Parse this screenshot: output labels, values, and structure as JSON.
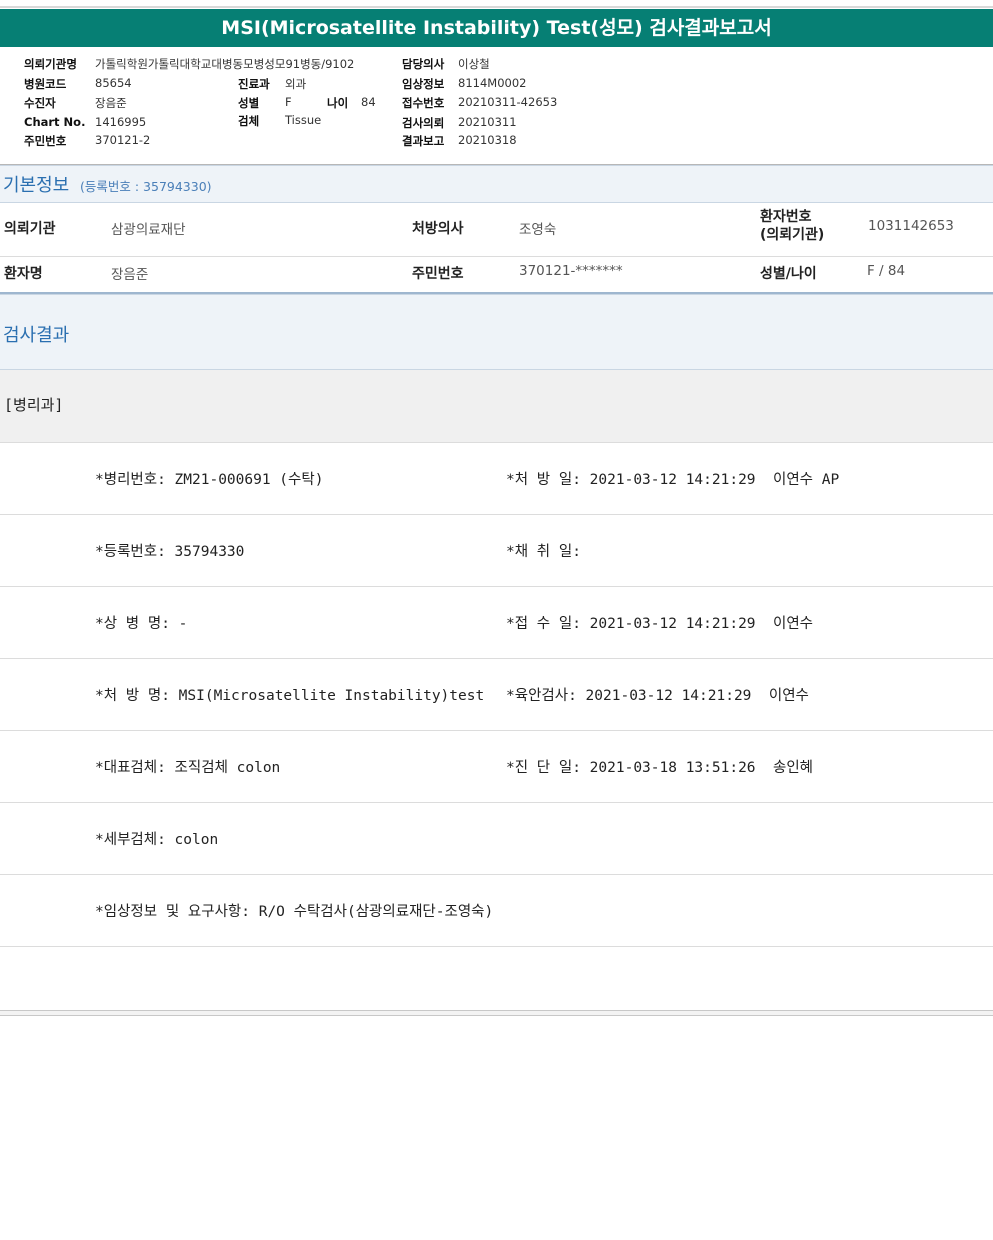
{
  "title": "MSI(Microsatellite Instability) Test(성모) 검사결과보고서",
  "header": {
    "col1": [
      {
        "label": "의뢰기관명",
        "value": "가톨릭학원가톨릭대학교대병동모병성모91병동/9102"
      },
      {
        "label": "병원코드",
        "value": "85654"
      },
      {
        "label": "수진자",
        "value": "장음준"
      },
      {
        "label": "Chart No.",
        "value": "1416995"
      },
      {
        "label": "주민번호",
        "value": "370121-2"
      }
    ],
    "col2": [
      {
        "label": "진료과",
        "value": "외과"
      },
      {
        "label": "성별",
        "value": "F"
      },
      {
        "label": "검체",
        "value": "Tissue"
      }
    ],
    "age": {
      "label": "나이",
      "value": "84"
    },
    "col3": [
      {
        "label": "담당의사",
        "value": "이상철"
      },
      {
        "label": "임상정보",
        "value": "8114M0002"
      },
      {
        "label": "접수번호",
        "value": "20210311-42653"
      },
      {
        "label": "검사의뢰",
        "value": "20210311"
      },
      {
        "label": "결과보고",
        "value": "20210318"
      }
    ]
  },
  "basic_info": {
    "title": "기본정보",
    "reg_no": "(등록번호 : 35794330)",
    "rows": [
      [
        {
          "label": "의뢰기관",
          "value": "삼광의료재단"
        },
        {
          "label": "처방의사",
          "value": "조영숙"
        },
        {
          "label": "환자번호\n(의뢰기관)",
          "value": "1031142653"
        }
      ],
      [
        {
          "label": "환자명",
          "value": "장음준"
        },
        {
          "label": "주민번호",
          "value": "370121-*******"
        },
        {
          "label": "성별/나이",
          "value": "F / 84"
        }
      ]
    ]
  },
  "result": {
    "title": "검사결과",
    "dept": "[병리과]",
    "rows": [
      {
        "left": "*병리번호: ZM21-000691 (수탁)",
        "right": "*처 방 일: 2021-03-12 14:21:29  이연수 AP"
      },
      {
        "left": "*등록번호: 35794330",
        "right": "*채 취 일:"
      },
      {
        "left": "*상 병 명: -",
        "right": "*접 수 일: 2021-03-12 14:21:29  이연수"
      },
      {
        "left": "*처 방 명: MSI(Microsatellite Instability)test",
        "right": "*육안검사: 2021-03-12 14:21:29  이연수"
      },
      {
        "left": "*대표검체: 조직검체 colon",
        "right": "*진 단 일: 2021-03-18 13:51:26  송인혜"
      },
      {
        "left": "*세부검체: colon",
        "right": ""
      },
      {
        "left": "*임상정보 및 요구사항: R/O 수탁검사(삼광의료재단-조영숙)",
        "right": ""
      }
    ]
  }
}
